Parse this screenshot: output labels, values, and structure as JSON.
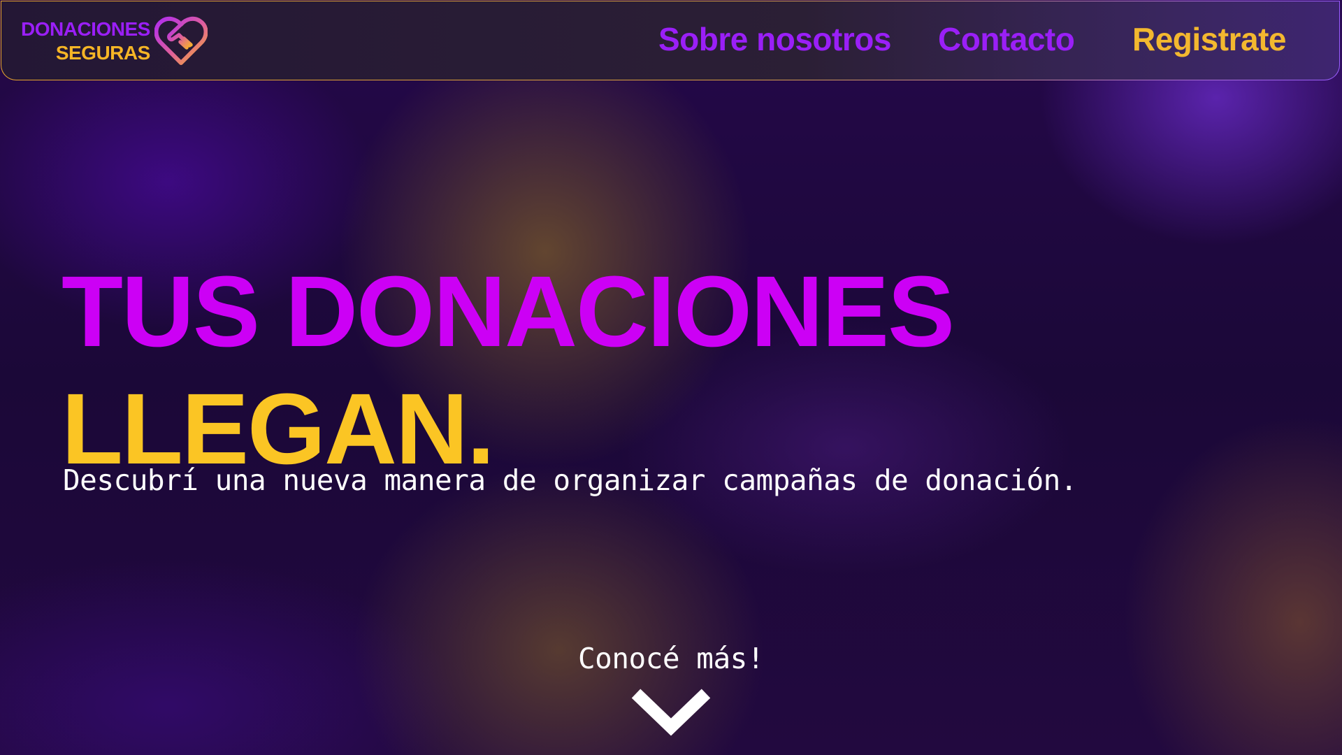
{
  "header": {
    "logo": {
      "line1": "DONACIONES",
      "line2": "SEGURAS",
      "icon": "heart-handshake-icon"
    },
    "nav": {
      "about": "Sobre nosotros",
      "contact": "Contacto",
      "register": "Registrate"
    }
  },
  "hero": {
    "title_line1": "TUS DONACIONES",
    "title_line2": "LLEGAN.",
    "subtitle": "Descubrí una nueva manera de organizar campañas de donación."
  },
  "cta": {
    "label": "Conocé más!",
    "icon": "chevron-down-icon"
  },
  "colors": {
    "purple": "#9a1ff7",
    "magenta": "#cc00f5",
    "yellow": "#fbc524",
    "background": "#1f0a3f"
  }
}
